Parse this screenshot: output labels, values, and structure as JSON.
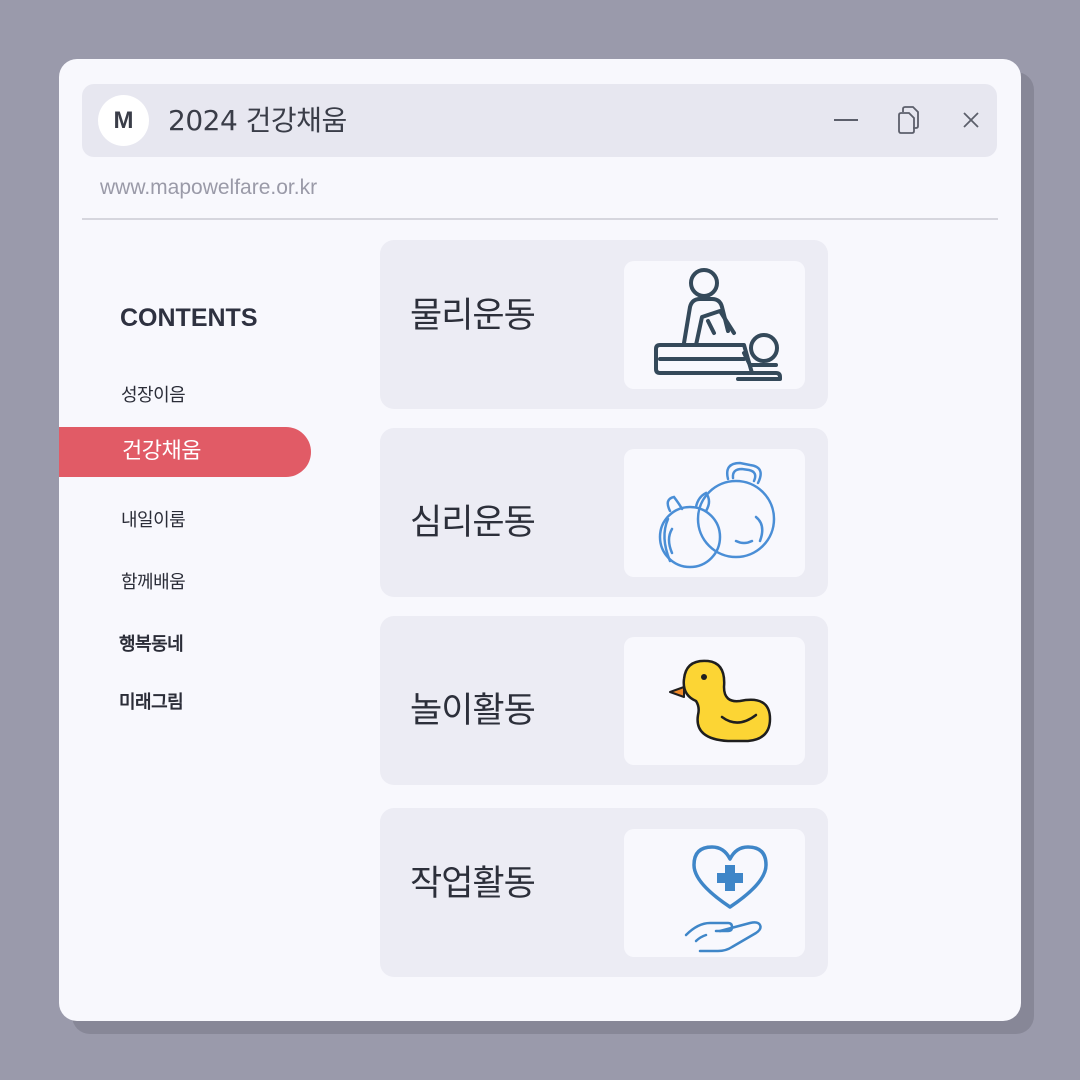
{
  "window": {
    "logo_letter": "M",
    "title": "2024 건강채움",
    "url": "www.mapowelfare.or.kr"
  },
  "sidebar": {
    "heading": "CONTENTS",
    "items": [
      {
        "label": "성장이음"
      },
      {
        "label": "건강채움"
      },
      {
        "label": "내일이룸"
      },
      {
        "label": "함께배움"
      },
      {
        "label": "행복동네"
      },
      {
        "label": "미래그림"
      }
    ],
    "active_color": "#e15b66"
  },
  "cards": [
    {
      "label": "물리운동",
      "icon": "massage-therapy-icon"
    },
    {
      "label": "심리운동",
      "icon": "exercise-balls-icon"
    },
    {
      "label": "놀이활동",
      "icon": "rubber-duck-icon"
    },
    {
      "label": "작업활동",
      "icon": "heart-care-hand-icon"
    }
  ]
}
